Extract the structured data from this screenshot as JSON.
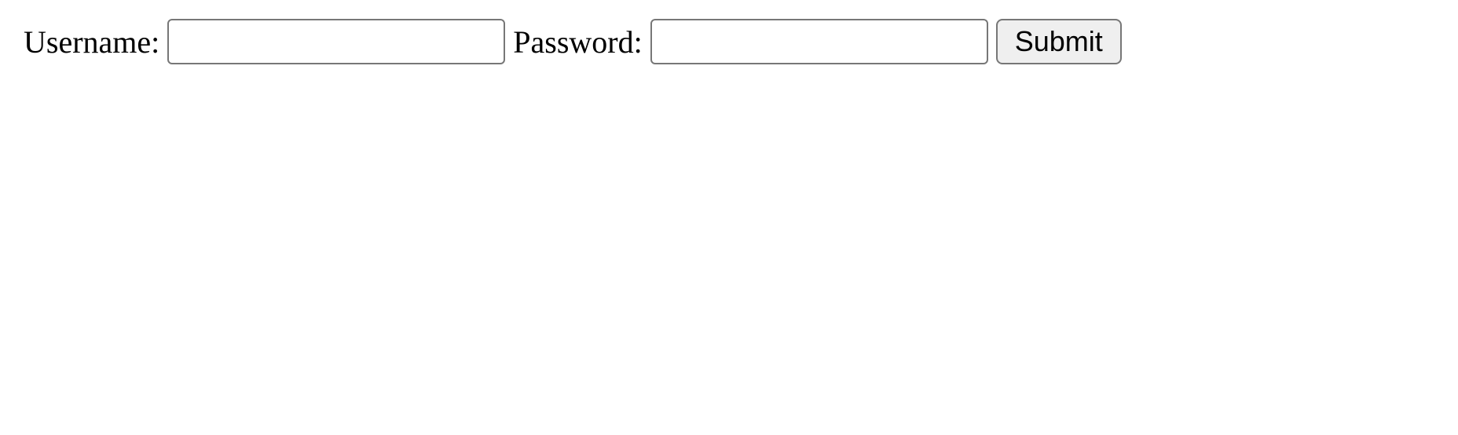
{
  "form": {
    "username_label": "Username:",
    "username_value": "",
    "password_label": "Password:",
    "password_value": "",
    "submit_label": "Submit"
  }
}
